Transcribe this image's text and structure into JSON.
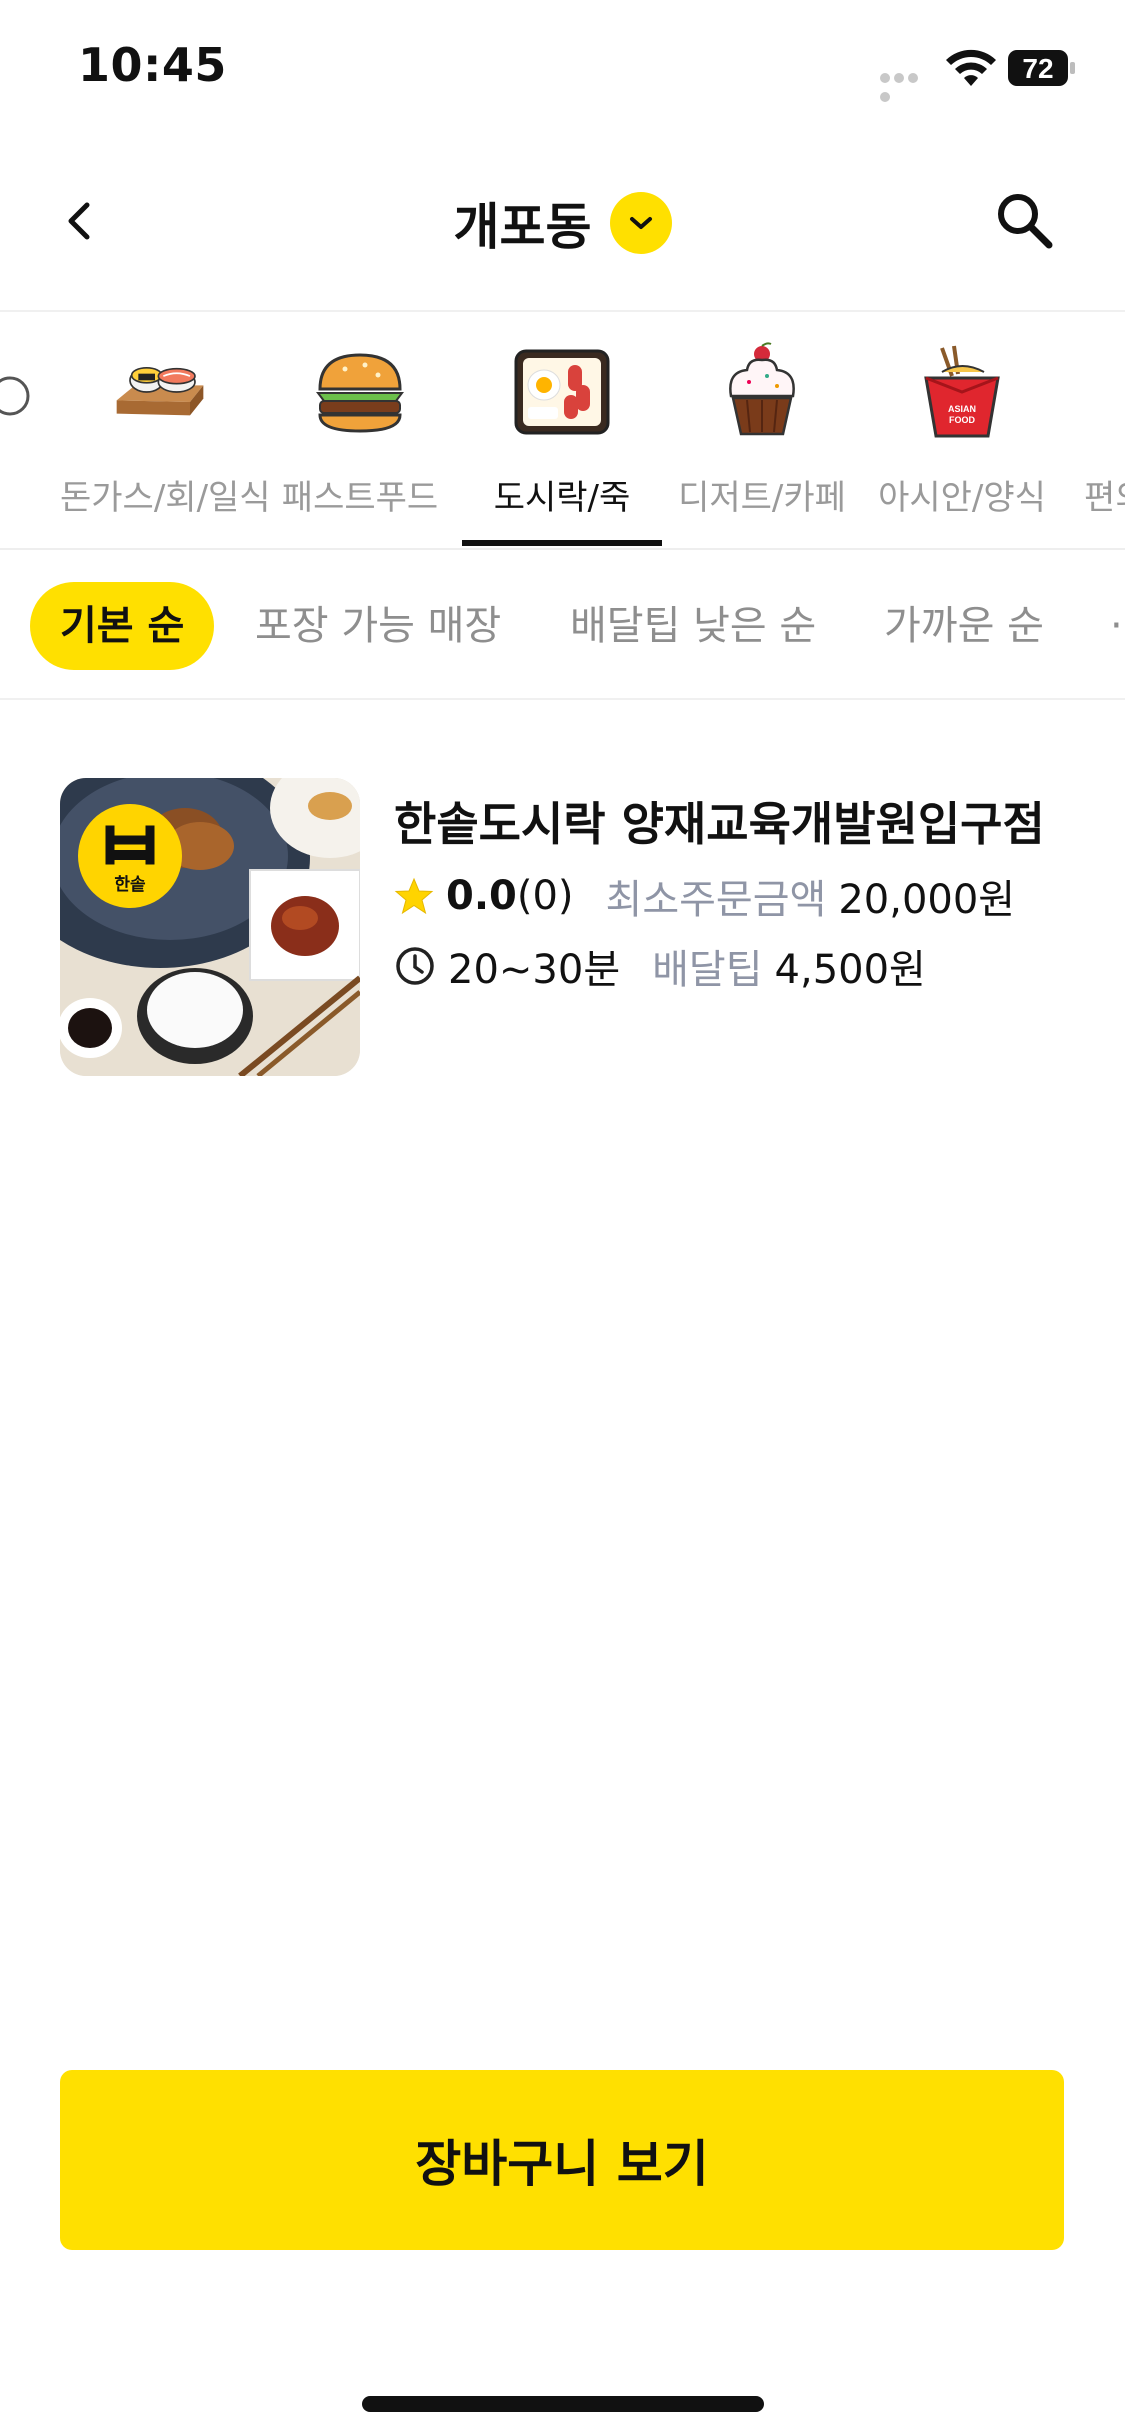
{
  "status_bar": {
    "time": "10:45",
    "battery": "72"
  },
  "header": {
    "title": "개포동",
    "back_icon": "chevron-left-icon",
    "dropdown_icon": "chevron-down-icon",
    "search_icon": "search-icon"
  },
  "categories": {
    "items": [
      {
        "label": "돈가스/회/일식",
        "icon": "sushi-icon"
      },
      {
        "label": "패스트푸드",
        "icon": "burger-icon"
      },
      {
        "label": "도시락/죽",
        "icon": "bento-icon"
      },
      {
        "label": "디저트/카페",
        "icon": "cupcake-icon"
      },
      {
        "label": "아시안/양식",
        "icon": "noodle-box-icon"
      },
      {
        "label": "편의",
        "icon": "convenience-icon"
      }
    ],
    "selected": "도시락/죽"
  },
  "sort": {
    "options": [
      "기본 순",
      "포장 가능 매장",
      "배달팁 낮은 순",
      "가까운 순"
    ],
    "selected": "기본 순"
  },
  "stores": [
    {
      "name": "한솥도시락 양재교육개발원입구점",
      "logo_text": "한솥",
      "rating": "0.0",
      "review_count": "(0)",
      "min_order_label": "최소주문금액",
      "min_order_value": "20,000원",
      "delivery_time": "20~30분",
      "delivery_tip_label": "배달팁",
      "delivery_tip_value": "4,500원"
    }
  ],
  "cart": {
    "label": "장바구니 보기"
  },
  "colors": {
    "accent": "#FFE000",
    "muted_label": "#8f95a6",
    "inactive_text": "#9a9a9a"
  }
}
